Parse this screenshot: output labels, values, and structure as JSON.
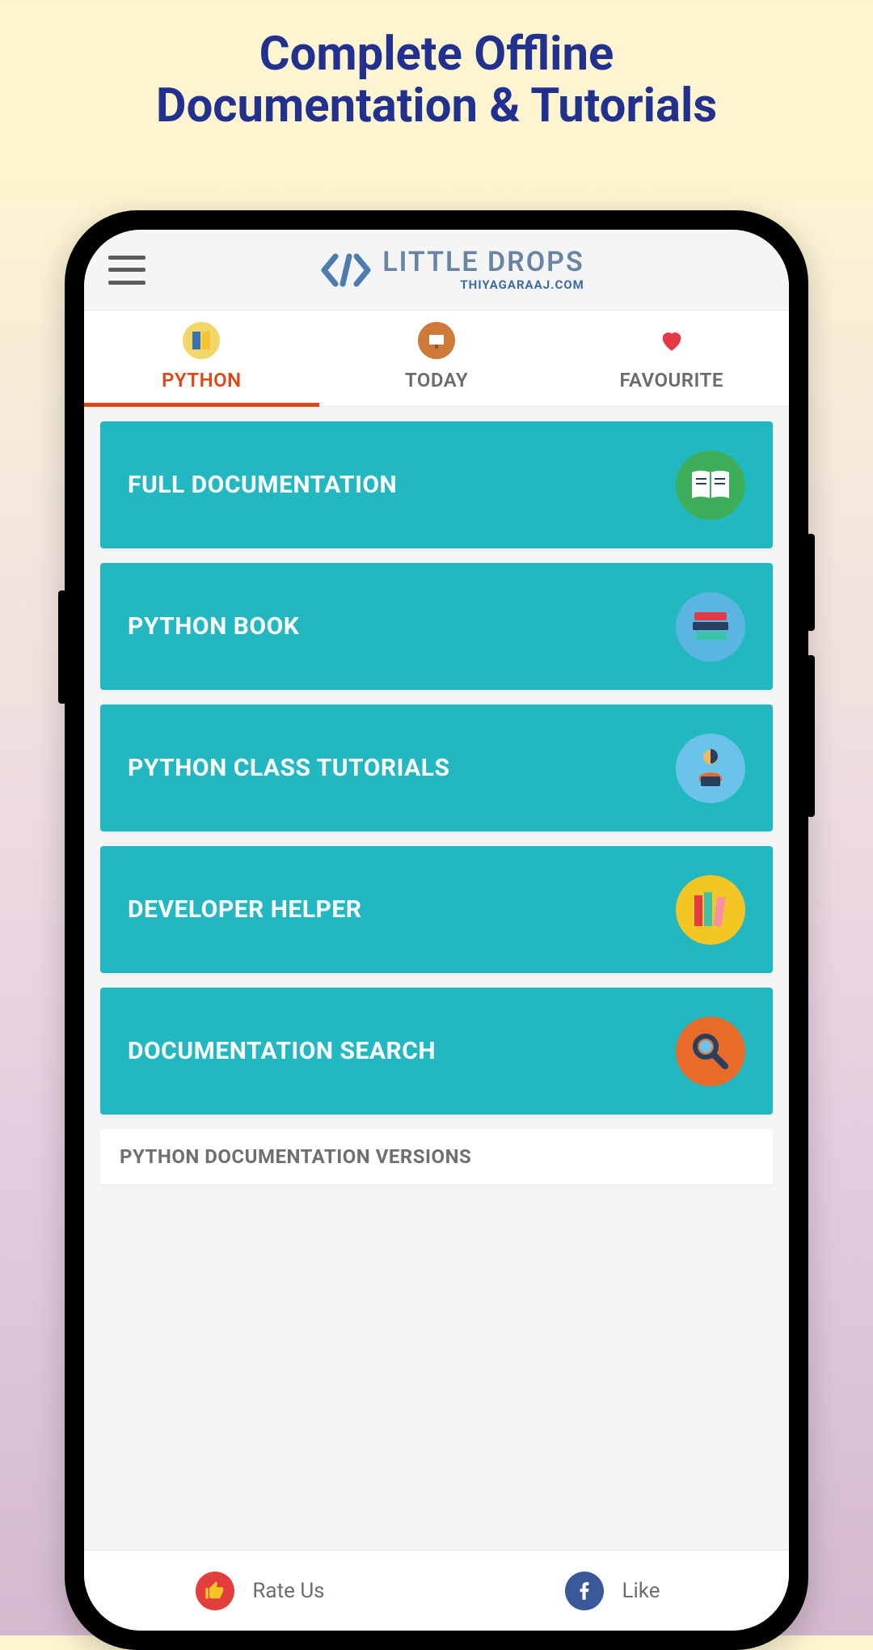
{
  "hero": {
    "title": "Complete Offline Documentation & Tutorials"
  },
  "header": {
    "brand_title": "LITTLE DROPS",
    "brand_sub": "THIYAGARAAJ.COM"
  },
  "tabs": [
    {
      "label": "PYTHON",
      "active": true,
      "icon": "python-tab-icon"
    },
    {
      "label": "TODAY",
      "active": false,
      "icon": "today-tab-icon"
    },
    {
      "label": "FAVOURITE",
      "active": false,
      "icon": "heart-icon"
    }
  ],
  "cards": [
    {
      "title": "FULL DOCUMENTATION",
      "icon": "book-open-icon",
      "icon_bg": "green"
    },
    {
      "title": "PYTHON BOOK",
      "icon": "books-stack-icon",
      "icon_bg": "blue"
    },
    {
      "title": "PYTHON CLASS TUTORIALS",
      "icon": "person-laptop-icon",
      "icon_bg": "lblue"
    },
    {
      "title": "DEVELOPER HELPER",
      "icon": "books-upright-icon",
      "icon_bg": "yellow"
    },
    {
      "title": "DOCUMENTATION SEARCH",
      "icon": "magnifier-icon",
      "icon_bg": "orange"
    }
  ],
  "section": {
    "heading": "PYTHON DOCUMENTATION VERSIONS"
  },
  "bottom": [
    {
      "label": "Rate Us",
      "icon": "thumbs-up-icon"
    },
    {
      "label": "Like",
      "icon": "facebook-icon"
    }
  ]
}
